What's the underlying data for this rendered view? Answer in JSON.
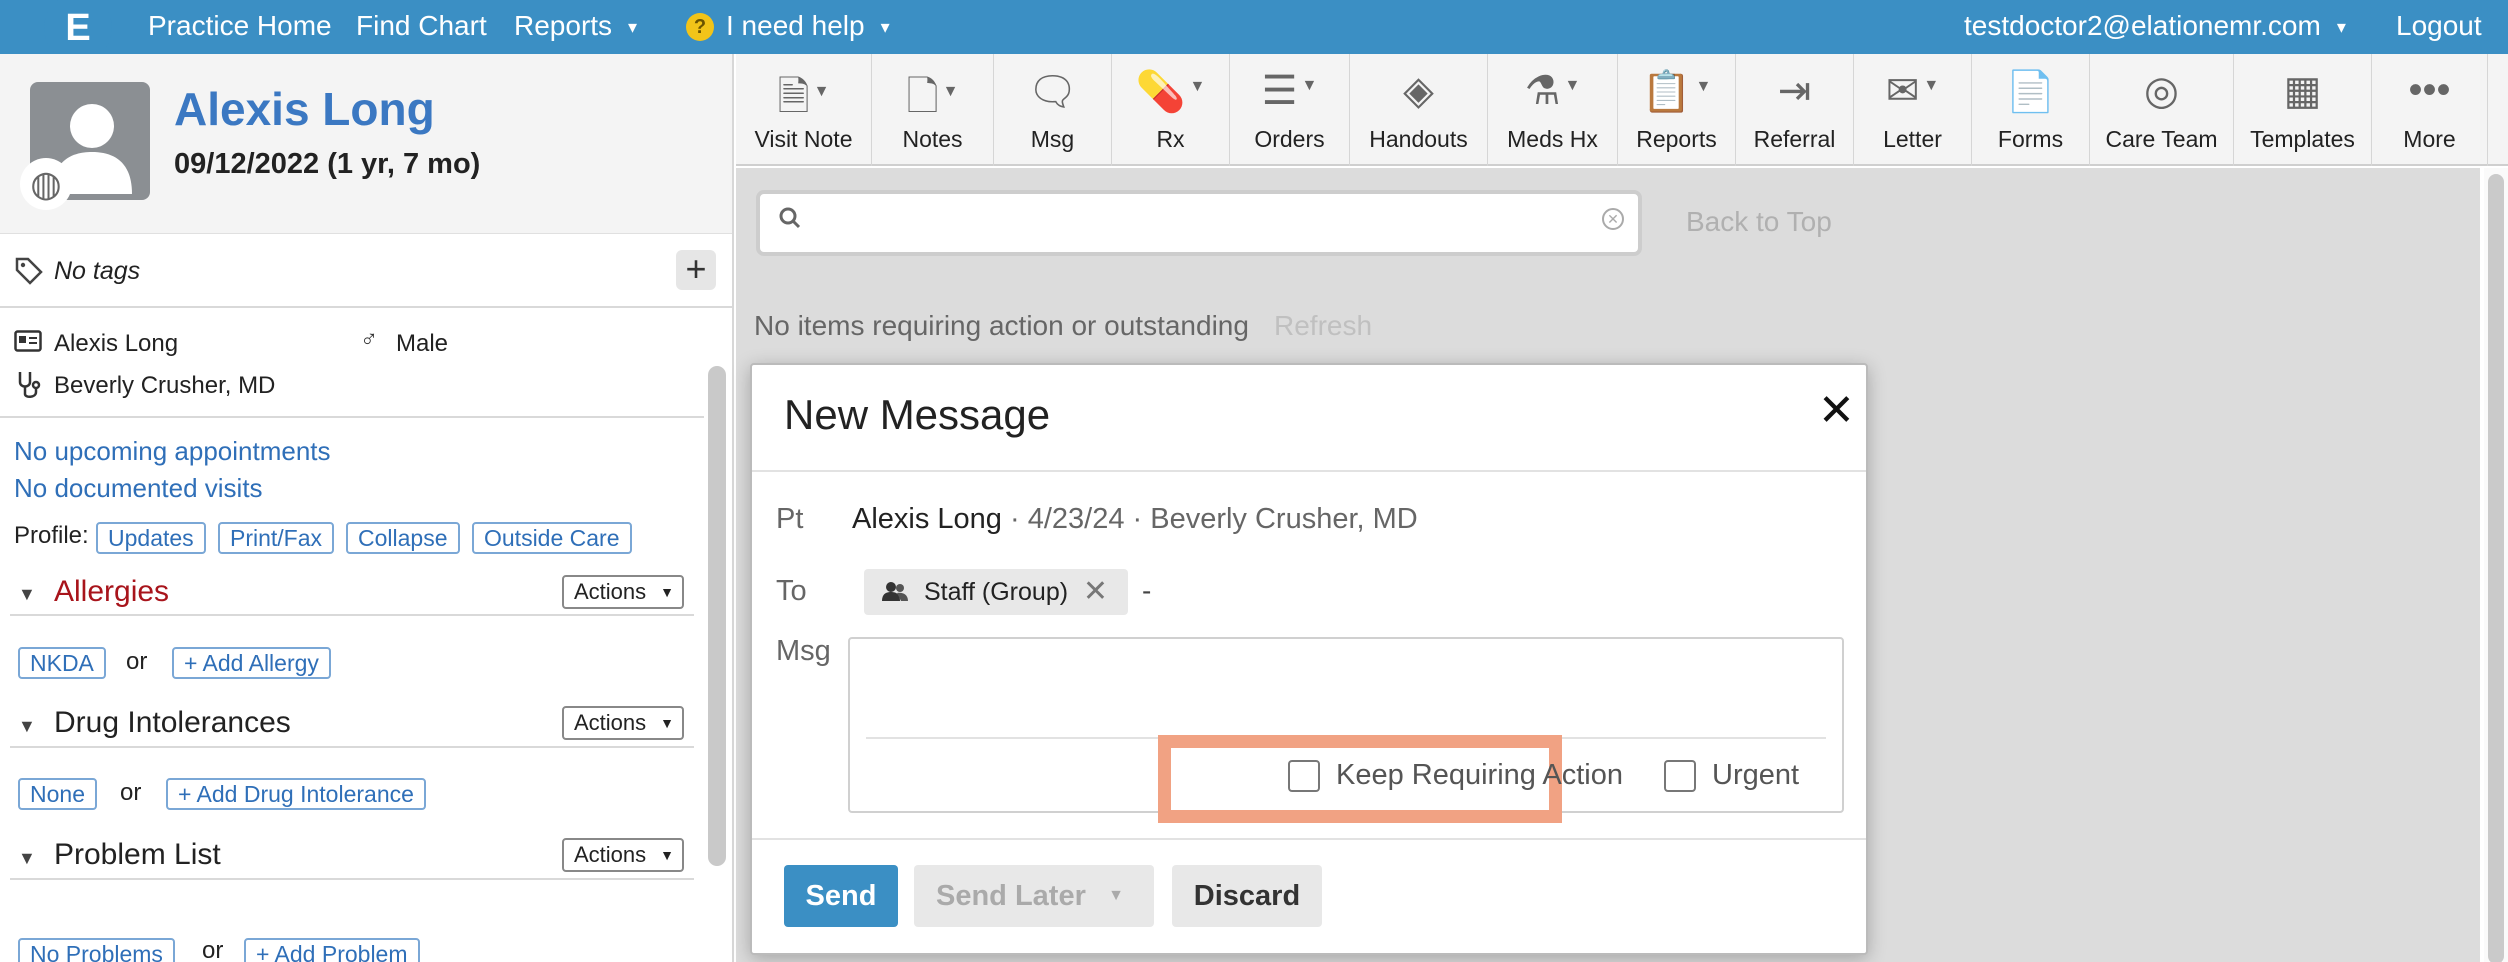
{
  "nav": {
    "logo_letter": "E",
    "practice_home": "Practice Home",
    "find_chart": "Find Chart",
    "reports": "Reports",
    "help_glyph": "?",
    "help": "I need help",
    "user": "testdoctor2@elationemr.com",
    "logout": "Logout"
  },
  "patient": {
    "name": "Alexis Long",
    "dob": "09/12/2022 (1 yr, 7 mo)",
    "tags": "No tags",
    "display_name": "Alexis Long",
    "sex": "Male",
    "provider": "Beverly Crusher, MD",
    "appointments": "No upcoming appointments",
    "visits": "No documented visits"
  },
  "profile": {
    "label": "Profile:",
    "buttons": [
      "Updates",
      "Print/Fax",
      "Collapse",
      "Outside Care"
    ]
  },
  "sections": {
    "allergies": {
      "title": "Allergies",
      "actions": "Actions",
      "none": "NKDA",
      "or": "or",
      "add": "+ Add Allergy"
    },
    "drug_intolerances": {
      "title": "Drug Intolerances",
      "actions": "Actions",
      "none": "None",
      "or": "or",
      "add": "+ Add Drug Intolerance"
    },
    "problem_list": {
      "title": "Problem List",
      "actions": "Actions",
      "none": "No Problems",
      "or": "or",
      "add": "+ Add Problem"
    }
  },
  "toolbar": {
    "items": [
      {
        "label": "Visit Note",
        "icon": "document-icon"
      },
      {
        "label": "Notes",
        "icon": "note-icon"
      },
      {
        "label": "Msg",
        "icon": "message-icon"
      },
      {
        "label": "Rx",
        "icon": "pill-icon"
      },
      {
        "label": "Orders",
        "icon": "list-icon"
      },
      {
        "label": "Handouts",
        "icon": "layers-icon"
      },
      {
        "label": "Meds Hx",
        "icon": "meds-icon"
      },
      {
        "label": "Reports",
        "icon": "clipboard-chart-icon"
      },
      {
        "label": "Referral",
        "icon": "referral-icon"
      },
      {
        "label": "Letter",
        "icon": "envelope-icon"
      },
      {
        "label": "Forms",
        "icon": "clipboard-icon"
      },
      {
        "label": "Care Team",
        "icon": "team-icon"
      },
      {
        "label": "Templates",
        "icon": "template-icon"
      },
      {
        "label": "More",
        "icon": "ellipsis-icon"
      }
    ]
  },
  "main": {
    "search_placeholder": "",
    "back_to_top": "Back to Top",
    "no_items": "No items requiring action or outstanding",
    "refresh": "Refresh"
  },
  "modal": {
    "title": "New Message",
    "pt_label": "Pt",
    "pt_name": "Alexis Long",
    "pt_rest": " · 4/23/24 · Beverly Crusher, MD",
    "to_label": "To",
    "recipient": "Staff (Group)",
    "to_dash": "-",
    "msg_label": "Msg",
    "msg_value": "",
    "keep_requiring_action": "Keep Requiring Action",
    "urgent": "Urgent",
    "send": "Send",
    "send_later": "Send Later",
    "discard": "Discard"
  },
  "colors": {
    "nav_bg": "#3b8fc4",
    "link_blue": "#2f6fb8",
    "allergy_red": "#a8141b",
    "highlight": "#f1a283"
  }
}
